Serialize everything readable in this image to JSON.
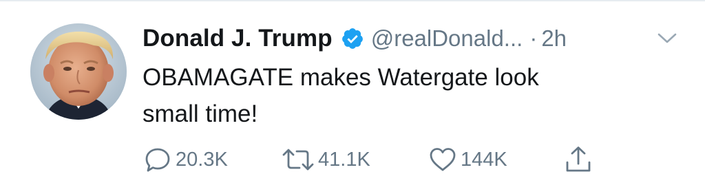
{
  "tweet": {
    "author_name": "Donald J. Trump",
    "handle": "@realDonald...",
    "separator": "·",
    "time": "2h",
    "text_lines": [
      "OBAMAGATE makes Watergate look",
      "small time!"
    ],
    "verified": true
  },
  "actions": {
    "reply_count": "20.3K",
    "retweet_count": "41.1K",
    "like_count": "144K"
  },
  "icons": {
    "verified": "verified-badge-icon",
    "caret": "chevron-down-icon",
    "reply": "reply-icon",
    "retweet": "retweet-icon",
    "like": "heart-icon",
    "share": "share-icon"
  },
  "colors": {
    "text": "#14171a",
    "secondary": "#657786",
    "verified_blue": "#1da1f2"
  }
}
